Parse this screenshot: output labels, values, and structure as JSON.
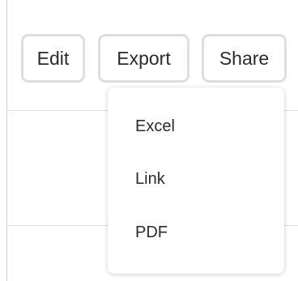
{
  "toolbar": {
    "edit_label": "Edit",
    "export_label": "Export",
    "share_label": "Share"
  },
  "export_menu": {
    "items": [
      {
        "label": "Excel"
      },
      {
        "label": "Link"
      },
      {
        "label": "PDF"
      }
    ]
  }
}
